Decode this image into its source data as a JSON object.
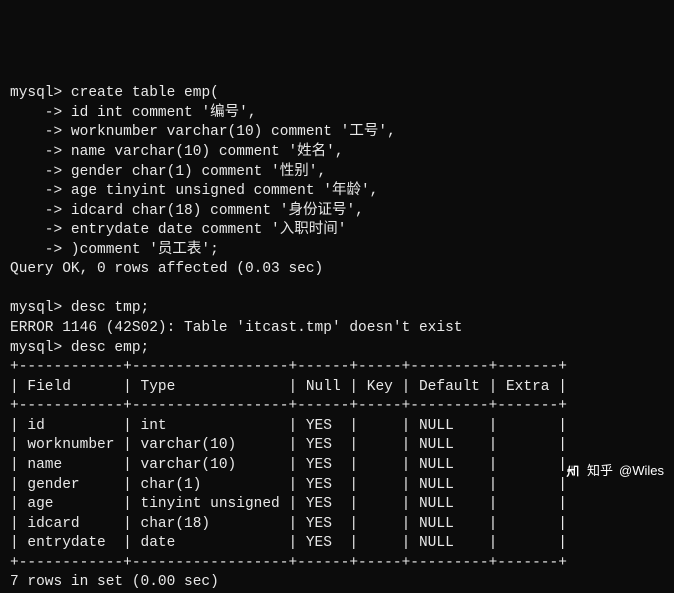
{
  "prompt": "mysql>",
  "cont": "    ->",
  "cmds": {
    "create": [
      "create table emp(",
      "id int comment '编号',",
      "worknumber varchar(10) comment '工号',",
      "name varchar(10) comment '姓名',",
      "gender char(1) comment '性别',",
      "age tinyint unsigned comment '年龄',",
      "idcard char(18) comment '身份证号',",
      "entrydate date comment '入职时间'",
      ")comment '员工表';"
    ],
    "create_ok": "Query OK, 0 rows affected (0.03 sec)",
    "desc_tmp": "desc tmp;",
    "error": "ERROR 1146 (42S02): Table 'itcast.tmp' doesn't exist",
    "desc_emp": "desc emp;"
  },
  "table": {
    "border_top": "+------------+------------------+------+-----+---------+-------+",
    "border_mid": "+------------+------------------+------+-----+---------+-------+",
    "border_bot": "+------------+------------------+------+-----+---------+-------+",
    "header": "| Field      | Type             | Null | Key | Default | Extra |",
    "rows": [
      "| id         | int              | YES  |     | NULL    |       |",
      "| worknumber | varchar(10)      | YES  |     | NULL    |       |",
      "| name       | varchar(10)      | YES  |     | NULL    |       |",
      "| gender     | char(1)          | YES  |     | NULL    |       |",
      "| age        | tinyint unsigned | YES  |     | NULL    |       |",
      "| idcard     | char(18)         | YES  |     | NULL    |       |",
      "| entrydate  | date             | YES  |     | NULL    |       |"
    ],
    "footer": "7 rows in set (0.00 sec)"
  },
  "chart_data": {
    "type": "table",
    "title": "desc emp",
    "columns": [
      "Field",
      "Type",
      "Null",
      "Key",
      "Default",
      "Extra"
    ],
    "rows": [
      [
        "id",
        "int",
        "YES",
        "",
        "NULL",
        ""
      ],
      [
        "worknumber",
        "varchar(10)",
        "YES",
        "",
        "NULL",
        ""
      ],
      [
        "name",
        "varchar(10)",
        "YES",
        "",
        "NULL",
        ""
      ],
      [
        "gender",
        "char(1)",
        "YES",
        "",
        "NULL",
        ""
      ],
      [
        "age",
        "tinyint unsigned",
        "YES",
        "",
        "NULL",
        ""
      ],
      [
        "idcard",
        "char(18)",
        "YES",
        "",
        "NULL",
        ""
      ],
      [
        "entrydate",
        "date",
        "YES",
        "",
        "NULL",
        ""
      ]
    ]
  },
  "watermark": {
    "site": "知乎",
    "author": "@Wiles"
  }
}
